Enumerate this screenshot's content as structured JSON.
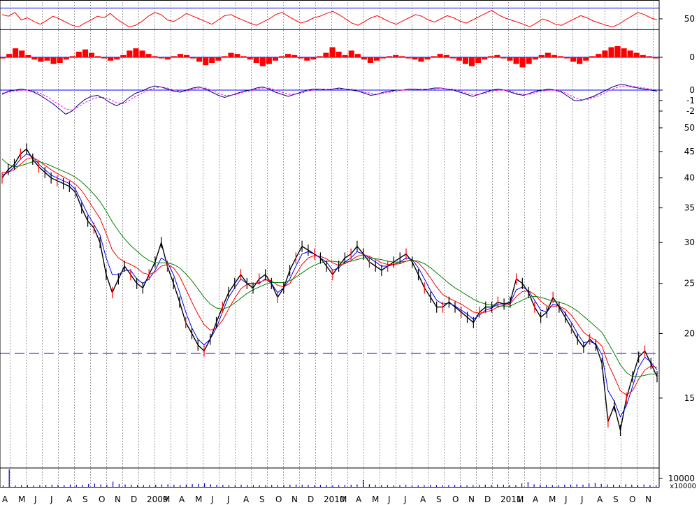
{
  "chart_data": [
    {
      "type": "line",
      "panel": "oscillator-rsi",
      "y_ticks": [
        "50"
      ],
      "levels": [
        70,
        30
      ],
      "ylim": [
        20,
        80
      ],
      "series": [
        {
          "color": "#ff0000",
          "values": [
            58,
            55,
            62,
            48,
            52,
            45,
            40,
            47,
            55,
            50,
            44,
            38,
            35,
            42,
            48,
            55,
            52,
            60,
            50,
            42,
            35,
            38,
            45,
            55,
            62,
            58,
            48,
            45,
            52,
            60,
            55,
            50,
            45,
            40,
            48,
            56,
            58,
            52,
            47,
            42,
            38,
            44,
            50,
            58,
            62,
            55,
            48,
            42,
            46,
            52,
            55,
            60,
            64,
            58,
            50,
            42,
            38,
            45,
            52,
            56,
            50,
            44,
            40,
            46,
            52,
            58,
            55,
            48,
            44,
            50,
            56,
            52,
            46,
            42,
            48,
            54,
            60,
            66,
            58,
            52,
            48,
            44,
            40,
            35,
            42,
            50,
            46,
            40,
            38,
            44,
            50,
            56,
            52,
            46,
            42,
            38,
            35,
            40,
            48,
            55,
            62,
            58,
            52,
            48
          ]
        }
      ]
    },
    {
      "type": "bar",
      "panel": "oscillator-histogram",
      "y_ticks": [
        "0"
      ],
      "ylim": [
        -1,
        1
      ],
      "bar_color": "#ff0000",
      "values": [
        -0.1,
        0.3,
        0.8,
        0.6,
        0.2,
        -0.2,
        -0.4,
        -0.3,
        -0.6,
        -0.5,
        -0.2,
        0.1,
        0.5,
        0.7,
        0.4,
        0.1,
        -0.1,
        -0.3,
        -0.2,
        0.2,
        0.6,
        0.8,
        0.6,
        0.3,
        0.1,
        -0.1,
        -0.2,
        0.1,
        0.3,
        0.2,
        -0.1,
        -0.4,
        -0.7,
        -0.5,
        -0.3,
        0.1,
        0.4,
        0.3,
        0.1,
        -0.2,
        -0.5,
        -0.8,
        -0.6,
        -0.3,
        0.1,
        0.3,
        0.2,
        -0.1,
        -0.3,
        -0.2,
        0.1,
        0.4,
        0.9,
        0.5,
        0.2,
        0.6,
        0.3,
        -0.2,
        -0.5,
        -0.3,
        -0.1,
        0.1,
        0.2,
        0.1,
        -0.1,
        -0.2,
        -0.4,
        -0.2,
        0.1,
        0.3,
        0.2,
        -0.1,
        -0.3,
        -0.6,
        -0.8,
        -0.5,
        -0.2,
        0.1,
        0.2,
        -0.1,
        -0.3,
        -0.6,
        -0.9,
        -0.6,
        -0.2,
        0.2,
        0.4,
        0.2,
        0.1,
        -0.1,
        -0.4,
        -0.6,
        -0.3,
        0.1,
        0.3,
        0.6,
        0.9,
        1.0,
        0.8,
        0.6,
        0.4,
        0.2,
        0.1,
        -0.1
      ]
    },
    {
      "type": "line",
      "panel": "oscillator-macd",
      "y_ticks": [
        "0",
        "-1",
        "-2"
      ],
      "ylim": [
        -2.8,
        0.6
      ],
      "series": [
        {
          "color": "#000080",
          "values": [
            -0.4,
            -0.1,
            0.0,
            0.1,
            0.0,
            -0.2,
            -0.5,
            -0.9,
            -1.3,
            -1.8,
            -2.3,
            -2.0,
            -1.4,
            -0.9,
            -0.6,
            -0.5,
            -0.8,
            -1.2,
            -1.5,
            -1.2,
            -0.7,
            -0.3,
            -0.1,
            0.2,
            0.4,
            0.3,
            0.1,
            -0.1,
            -0.2,
            0.0,
            0.2,
            0.3,
            0.1,
            -0.2,
            -0.5,
            -0.7,
            -0.5,
            -0.3,
            -0.1,
            0.0,
            0.2,
            0.3,
            0.1,
            -0.2,
            -0.4,
            -0.6,
            -0.4,
            -0.2,
            0.0,
            0.1,
            0.1,
            0.0,
            0.1,
            0.2,
            0.1,
            0.0,
            -0.1,
            -0.3,
            -0.5,
            -0.4,
            -0.2,
            -0.1,
            0.0,
            0.0,
            0.1,
            0.1,
            0.0,
            0.1,
            0.2,
            0.2,
            0.1,
            0.0,
            -0.2,
            -0.4,
            -0.6,
            -0.4,
            -0.2,
            0.0,
            0.1,
            0.0,
            -0.2,
            -0.4,
            -0.5,
            -0.3,
            -0.1,
            0.0,
            0.1,
            0.0,
            -0.2,
            -0.6,
            -1.0,
            -1.0,
            -0.8,
            -0.6,
            -0.3,
            0.0,
            0.3,
            0.5,
            0.5,
            0.3,
            0.2,
            0.1,
            0.0,
            -0.1
          ]
        },
        {
          "color": "#ff00ff",
          "dashed": true,
          "values": [
            -0.3,
            -0.2,
            -0.1,
            0.0,
            0.0,
            -0.1,
            -0.3,
            -0.6,
            -1.0,
            -1.4,
            -1.8,
            -1.9,
            -1.6,
            -1.2,
            -0.9,
            -0.7,
            -0.7,
            -0.9,
            -1.2,
            -1.3,
            -1.0,
            -0.6,
            -0.3,
            0.0,
            0.2,
            0.3,
            0.2,
            0.0,
            -0.1,
            -0.1,
            0.1,
            0.2,
            0.2,
            0.0,
            -0.3,
            -0.5,
            -0.5,
            -0.4,
            -0.2,
            -0.1,
            0.1,
            0.2,
            0.2,
            0.0,
            -0.2,
            -0.4,
            -0.4,
            -0.3,
            -0.1,
            0.0,
            0.1,
            0.1,
            0.1,
            0.1,
            0.1,
            0.1,
            0.0,
            -0.2,
            -0.3,
            -0.4,
            -0.3,
            -0.2,
            -0.1,
            0.0,
            0.0,
            0.1,
            0.1,
            0.1,
            0.1,
            0.2,
            0.1,
            0.1,
            -0.1,
            -0.3,
            -0.4,
            -0.4,
            -0.3,
            -0.1,
            0.0,
            0.0,
            -0.1,
            -0.3,
            -0.4,
            -0.4,
            -0.2,
            -0.1,
            0.0,
            0.0,
            -0.1,
            -0.4,
            -0.7,
            -0.9,
            -0.9,
            -0.7,
            -0.5,
            -0.2,
            0.1,
            0.3,
            0.4,
            0.4,
            0.3,
            0.2,
            0.1,
            0.0
          ]
        }
      ]
    },
    {
      "type": "line",
      "panel": "price",
      "scale": "log",
      "ylim": [
        12.2,
        52
      ],
      "y_ticks": [
        "50",
        "45",
        "40",
        "35",
        "30",
        "25",
        "20",
        "15"
      ],
      "support_level": {
        "value": 18.3,
        "color": "#0000ff",
        "style": "dashed"
      },
      "series": [
        {
          "color": "#000000",
          "values": [
            40.0,
            41.5,
            42.5,
            44.5,
            45.5,
            43.5,
            42.0,
            41.0,
            40.0,
            39.5,
            39.0,
            38.5,
            37.5,
            35.0,
            33.0,
            32.0,
            30.0,
            26.0,
            24.0,
            25.5,
            27.0,
            26.0,
            25.0,
            24.5,
            26.0,
            27.5,
            30.0,
            27.0,
            25.0,
            23.0,
            21.0,
            20.0,
            19.0,
            18.5,
            19.5,
            21.0,
            22.5,
            24.0,
            25.0,
            26.0,
            25.0,
            24.5,
            25.5,
            26.0,
            25.0,
            23.5,
            24.5,
            26.5,
            28.0,
            29.5,
            29.0,
            28.5,
            28.0,
            27.0,
            26.0,
            27.0,
            28.0,
            28.5,
            29.5,
            28.5,
            27.5,
            27.0,
            26.5,
            27.0,
            27.5,
            28.0,
            28.5,
            27.5,
            26.0,
            24.5,
            23.5,
            22.5,
            22.5,
            23.0,
            22.5,
            22.0,
            21.5,
            21.0,
            22.0,
            22.5,
            22.5,
            23.0,
            22.8,
            23.0,
            25.5,
            25.0,
            24.0,
            22.5,
            21.5,
            22.0,
            23.5,
            22.5,
            21.5,
            20.5,
            19.5,
            18.8,
            19.5,
            19.0,
            17.5,
            13.5,
            14.5,
            13.0,
            15.0,
            16.5,
            18.0,
            18.5,
            17.5,
            16.5
          ]
        },
        {
          "color": "#0000ff",
          "values": [
            40.5,
            41.0,
            42.0,
            43.5,
            44.5,
            44.0,
            42.5,
            41.5,
            40.5,
            40.0,
            39.5,
            39.0,
            38.0,
            36.0,
            34.0,
            32.5,
            31.0,
            28.0,
            26.0,
            26.0,
            26.5,
            26.5,
            25.5,
            25.0,
            25.5,
            26.5,
            28.0,
            27.5,
            26.0,
            24.0,
            22.0,
            20.5,
            19.5,
            19.0,
            19.5,
            20.5,
            22.0,
            23.5,
            24.5,
            25.5,
            25.0,
            25.0,
            25.0,
            25.5,
            25.0,
            24.0,
            24.5,
            25.5,
            27.0,
            28.5,
            28.8,
            28.5,
            28.0,
            27.5,
            26.5,
            26.8,
            27.5,
            28.0,
            28.8,
            28.5,
            28.0,
            27.5,
            27.0,
            27.0,
            27.2,
            27.5,
            28.0,
            27.8,
            26.8,
            25.5,
            24.2,
            23.2,
            22.8,
            22.9,
            22.6,
            22.2,
            21.8,
            21.3,
            21.7,
            22.2,
            22.4,
            22.8,
            22.8,
            22.9,
            24.3,
            24.6,
            24.2,
            23.2,
            22.2,
            22.0,
            22.8,
            22.6,
            21.9,
            21.0,
            20.0,
            19.2,
            19.3,
            19.1,
            18.2,
            15.5,
            14.8,
            13.8,
            14.5,
            15.8,
            17.2,
            18.0,
            17.6,
            17.0
          ]
        },
        {
          "color": "#ff0000",
          "values": [
            41.0,
            41.0,
            41.5,
            42.5,
            43.5,
            43.8,
            43.2,
            42.3,
            41.5,
            40.8,
            40.2,
            39.6,
            38.9,
            37.8,
            36.3,
            34.8,
            33.4,
            31.2,
            29.0,
            28.0,
            27.5,
            27.2,
            26.8,
            26.2,
            26.0,
            26.3,
            27.0,
            27.2,
            26.8,
            25.8,
            24.4,
            23.0,
            21.8,
            20.8,
            20.3,
            20.5,
            21.2,
            22.3,
            23.4,
            24.4,
            24.9,
            25.0,
            25.1,
            25.4,
            25.3,
            24.8,
            24.6,
            25.0,
            26.0,
            27.2,
            28.0,
            28.3,
            28.2,
            27.9,
            27.4,
            27.1,
            27.3,
            27.7,
            28.2,
            28.4,
            28.2,
            27.8,
            27.4,
            27.2,
            27.2,
            27.3,
            27.6,
            27.8,
            27.4,
            26.6,
            25.6,
            24.6,
            23.8,
            23.4,
            23.1,
            22.8,
            22.4,
            22.0,
            21.9,
            22.0,
            22.2,
            22.5,
            22.7,
            22.8,
            23.6,
            24.1,
            24.2,
            23.8,
            23.1,
            22.6,
            22.6,
            22.6,
            22.3,
            21.7,
            20.9,
            20.1,
            19.7,
            19.4,
            18.9,
            17.5,
            16.5,
            15.5,
            15.2,
            15.5,
            16.3,
            17.0,
            17.3,
            17.2
          ]
        },
        {
          "color": "#008000",
          "values": [
            43.5,
            42.5,
            42.0,
            42.2,
            42.6,
            43.0,
            43.0,
            42.7,
            42.2,
            41.7,
            41.2,
            40.7,
            40.1,
            39.3,
            38.3,
            37.2,
            36.0,
            34.5,
            32.9,
            31.6,
            30.5,
            29.6,
            28.9,
            28.2,
            27.7,
            27.4,
            27.4,
            27.4,
            27.2,
            26.8,
            26.1,
            25.3,
            24.4,
            23.5,
            22.8,
            22.4,
            22.3,
            22.5,
            22.9,
            23.4,
            23.9,
            24.3,
            24.6,
            24.9,
            25.1,
            25.1,
            25.1,
            25.3,
            25.7,
            26.2,
            26.7,
            27.1,
            27.4,
            27.6,
            27.6,
            27.5,
            27.5,
            27.6,
            27.8,
            28.0,
            28.0,
            27.9,
            27.8,
            27.6,
            27.5,
            27.5,
            27.6,
            27.7,
            27.6,
            27.3,
            26.8,
            26.2,
            25.6,
            25.0,
            24.5,
            24.1,
            23.7,
            23.3,
            23.0,
            22.8,
            22.7,
            22.6,
            22.6,
            22.6,
            22.9,
            23.2,
            23.5,
            23.6,
            23.5,
            23.3,
            23.1,
            23.0,
            22.8,
            22.5,
            22.1,
            21.6,
            21.1,
            20.6,
            20.1,
            19.2,
            18.3,
            17.4,
            16.8,
            16.5,
            16.5,
            16.6,
            16.7,
            16.7
          ]
        }
      ]
    },
    {
      "type": "bar",
      "panel": "volume",
      "y_ticks": [
        "10000"
      ],
      "unit_label": "x10000",
      "bar_color": "#0000cc",
      "ylim": [
        0,
        8
      ],
      "values": [
        0.6,
        8.0,
        0.7,
        0.8,
        0.9,
        0.7,
        0.8,
        0.9,
        1.0,
        0.9,
        0.8,
        1.1,
        1.0,
        0.9,
        1.3,
        1.5,
        1.1,
        1.0,
        2.4,
        1.3,
        1.1,
        1.0,
        0.9,
        0.8,
        0.9,
        1.0,
        1.1,
        1.2,
        1.0,
        0.9,
        1.1,
        1.3,
        1.4,
        1.6,
        1.2,
        1.0,
        0.9,
        0.8,
        0.9,
        1.0,
        0.9,
        0.8,
        0.7,
        0.8,
        0.9,
        0.8,
        0.9,
        1.0,
        1.1,
        1.0,
        0.9,
        0.8,
        0.9,
        0.8,
        0.7,
        0.8,
        0.9,
        1.0,
        1.1,
        3.2,
        1.2,
        1.0,
        0.9,
        0.8,
        0.7,
        0.8,
        0.9,
        0.8,
        0.7,
        0.8,
        0.9,
        0.8,
        0.7,
        0.8,
        0.9,
        0.8,
        0.7,
        0.8,
        0.9,
        1.0,
        0.9,
        1.1,
        1.0,
        0.9,
        0.8,
        1.6,
        2.2,
        1.2,
        1.0,
        0.9,
        0.8,
        0.9,
        1.0,
        1.1,
        1.2,
        1.0,
        1.5,
        1.8,
        1.3,
        1.1,
        1.0,
        0.9,
        1.2,
        1.0,
        0.9,
        1.1,
        0.8,
        0.7
      ]
    }
  ],
  "x_axis": {
    "labels": [
      "A",
      "M",
      "J",
      "J",
      "A",
      "S",
      "O",
      "N",
      "D",
      "2009",
      "M",
      "A",
      "M",
      "J",
      "J",
      "A",
      "S",
      "O",
      "N",
      "D",
      "2010",
      "M",
      "A",
      "M",
      "J",
      "J",
      "A",
      "S",
      "O",
      "N",
      "D",
      "2011",
      "M",
      "A",
      "M",
      "J",
      "J",
      "A",
      "S",
      "O",
      "N"
    ]
  },
  "colors": {
    "background": "#ffffff",
    "frame": "#000000",
    "grid": "#a0a0a0",
    "reference_lines": "#0000ff"
  }
}
